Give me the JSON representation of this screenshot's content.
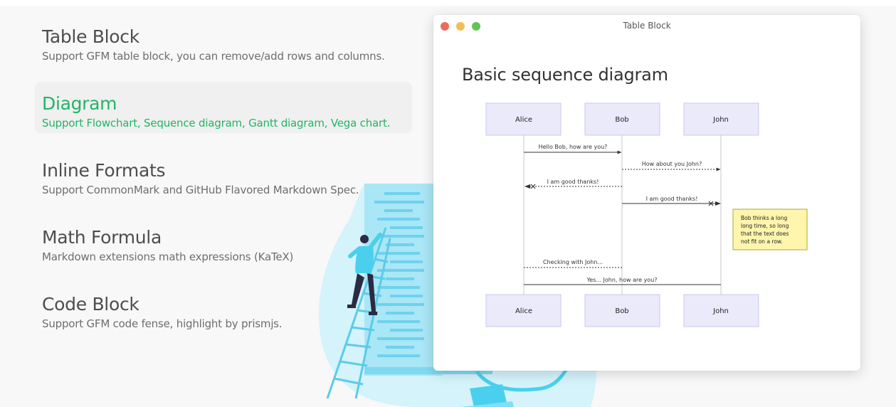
{
  "features": [
    {
      "title": "Table Block",
      "desc": "Support GFM table block, you can remove/add rows and columns.",
      "active": false
    },
    {
      "title": "Diagram",
      "desc": "Support Flowchart, Sequence diagram, Gantt diagram, Vega chart.",
      "active": true
    },
    {
      "title": "Inline Formats",
      "desc": "Support CommonMark and GitHub Flavored Markdown Spec.",
      "active": false
    },
    {
      "title": "Math Formula",
      "desc": "Markdown extensions math expressions (KaTeX)",
      "active": false
    },
    {
      "title": "Code Block",
      "desc": "Support GFM code fense, highlight by prismjs.",
      "active": false
    }
  ],
  "window": {
    "title": "Table Block",
    "heading": "Basic sequence diagram"
  },
  "sequence": {
    "participants": [
      "Alice",
      "Bob",
      "John"
    ],
    "messages": [
      {
        "label": "Hello Bob, how are you?"
      },
      {
        "label": "How about you John?"
      },
      {
        "label": "I am good thanks!"
      },
      {
        "label": "I am good thanks!"
      },
      {
        "label": "Checking with John..."
      },
      {
        "label": "Yes... John, how are you?"
      }
    ],
    "note": {
      "lines": [
        "Bob thinks a long",
        "long time, so long",
        "that the text does",
        "not fit on a row."
      ]
    }
  },
  "colors": {
    "accent": "#21b565",
    "participant_fill": "#eaeafb",
    "participant_stroke": "#c8c8ee",
    "note_fill": "#fff5ad",
    "note_stroke": "#aaaa33"
  }
}
